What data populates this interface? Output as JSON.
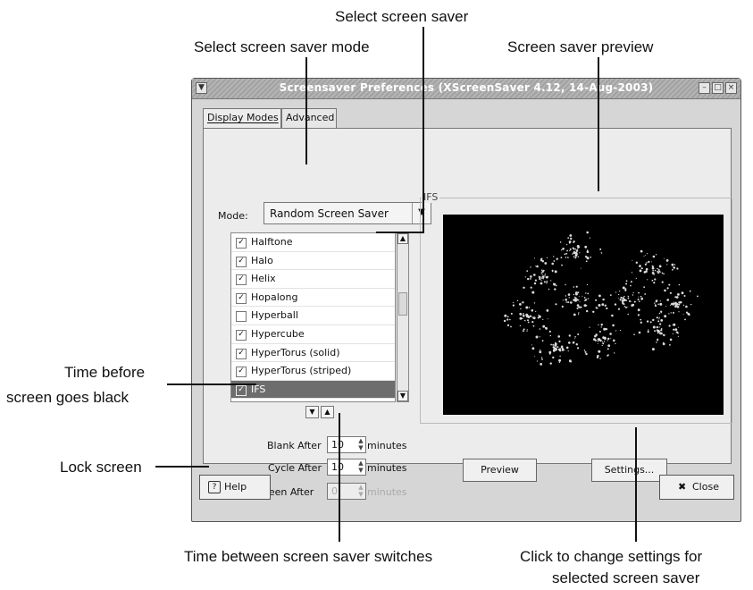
{
  "callouts": {
    "select_screen_saver": "Select screen saver",
    "select_mode": "Select screen saver mode",
    "preview": "Screen saver preview",
    "time_before_l1": "Time before",
    "time_before_l2": "screen goes black",
    "lock_screen": "Lock screen",
    "time_between": "Time between screen saver switches",
    "click_settings_l1": "Click to change settings for",
    "click_settings_l2": "selected screen saver"
  },
  "window": {
    "title": "Screensaver Preferences  (XScreenSaver 4.12, 14-Aug-2003)",
    "menu_icon": "chevron-down-icon",
    "controls": [
      "minimize-icon",
      "maximize-icon",
      "close-icon"
    ]
  },
  "tabs": [
    {
      "label": "Display Modes",
      "active": true
    },
    {
      "label": "Advanced",
      "active": false
    }
  ],
  "mode": {
    "label": "Mode:",
    "value": "Random Screen Saver"
  },
  "list": {
    "items": [
      {
        "name": "Halftone",
        "checked": true
      },
      {
        "name": "Halo",
        "checked": true
      },
      {
        "name": "Helix",
        "checked": true
      },
      {
        "name": "Hopalong",
        "checked": true
      },
      {
        "name": "Hyperball",
        "checked": false
      },
      {
        "name": "Hypercube",
        "checked": true
      },
      {
        "name": "HyperTorus (solid)",
        "checked": true
      },
      {
        "name": "HyperTorus (striped)",
        "checked": true
      },
      {
        "name": "IFS",
        "checked": true,
        "selected": true
      }
    ]
  },
  "preview_frame": {
    "label": "IFS"
  },
  "blank": {
    "label": "Blank After",
    "value": "10",
    "unit": "minutes"
  },
  "cycle": {
    "label": "Cycle After",
    "value": "10",
    "unit": "minutes"
  },
  "lock": {
    "label": "Lock Screen After",
    "value": "0",
    "unit": "minutes",
    "checked": false
  },
  "buttons": {
    "preview": "Preview",
    "settings": "Settings...",
    "help": "Help",
    "close": "Close"
  },
  "colors": {
    "selection": "#6d6d6d",
    "preview_bg": "#000000",
    "fractal": "#dcdcdc"
  }
}
